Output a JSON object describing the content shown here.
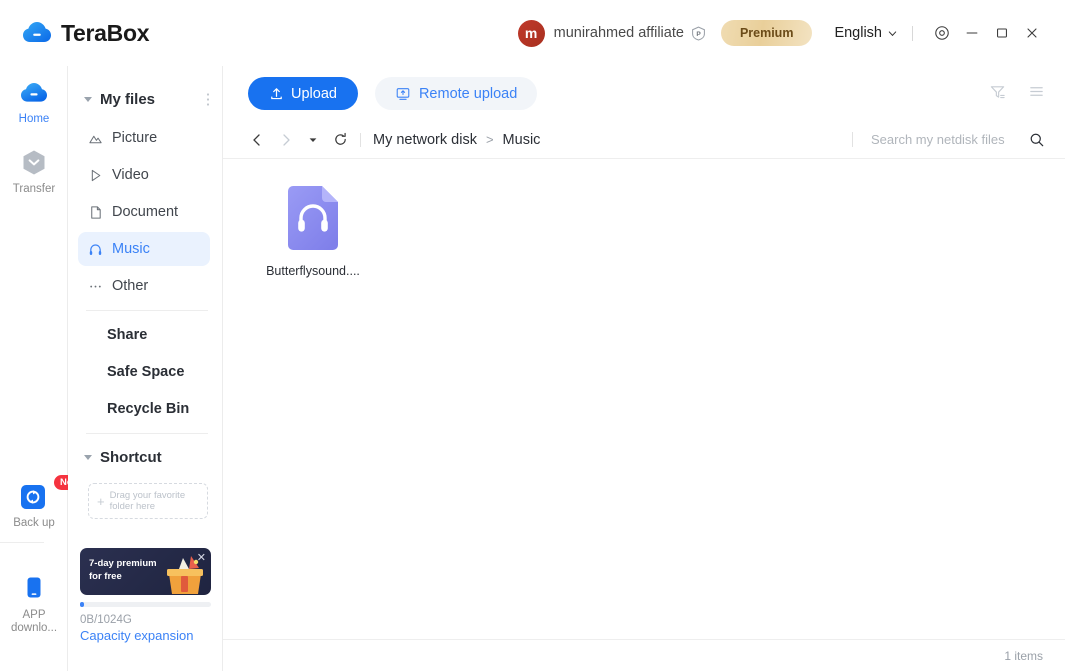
{
  "app": {
    "brand_name": "TeraBox",
    "logo_icon": "terabox-cloud-logo"
  },
  "titlebar": {
    "avatar_initial": "m",
    "username": "munirahmed affiliate",
    "p_badge_icon": "premium-p-shield-icon",
    "premium_label": "Premium",
    "language": "English",
    "language_caret_icon": "chevron-down-icon",
    "settings_icon": "settings-target-icon",
    "minimize_icon": "minimize-icon",
    "maximize_icon": "maximize-icon",
    "close_icon": "close-icon",
    "colors": {
      "avatar_bg": "#b8342a",
      "premium_bg": "#eed9ab",
      "premium_text": "#6b4b18",
      "brand_blue": "#1872f0"
    }
  },
  "rail": {
    "items": [
      {
        "label": "Home",
        "icon": "cloud-home-icon",
        "active": true
      },
      {
        "label": "Transfer",
        "icon": "transfer-hexagon-icon",
        "active": false
      },
      {
        "label": "Back up",
        "icon": "backup-sync-icon",
        "active": false,
        "badge": "New"
      },
      {
        "label": "APP downlo...",
        "icon": "app-download-phone-icon",
        "active": false
      }
    ]
  },
  "tree": {
    "header": {
      "label": "My files",
      "collapse_icon": "triangle-down-icon",
      "menu_icon": "more-vertical-icon"
    },
    "categories": [
      {
        "label": "Picture",
        "icon": "picture-icon",
        "selected": false
      },
      {
        "label": "Video",
        "icon": "video-play-icon",
        "selected": false
      },
      {
        "label": "Document",
        "icon": "document-icon",
        "selected": false
      },
      {
        "label": "Music",
        "icon": "headphones-icon",
        "selected": true
      },
      {
        "label": "Other",
        "icon": "ellipsis-icon",
        "selected": false
      }
    ],
    "links": [
      {
        "label": "Share"
      },
      {
        "label": "Safe Space"
      },
      {
        "label": "Recycle Bin"
      }
    ],
    "shortcut": {
      "label": "Shortcut",
      "collapse_icon": "triangle-down-icon",
      "dropzone_text": "Drag your favorite folder here",
      "dropzone_plus": "+"
    },
    "promo": {
      "line1": "7-day premium",
      "line2": "for free",
      "close_icon": "close-icon",
      "image_icon": "gift-box-icon"
    },
    "storage": {
      "used_total": "0B/1024G",
      "expand_link": "Capacity expansion",
      "percent": 0
    }
  },
  "toolbar": {
    "upload_label": "Upload",
    "upload_icon": "upload-arrow-icon",
    "remote_upload_label": "Remote upload",
    "remote_upload_icon": "remote-screen-icon",
    "filter_icon": "filter-sort-icon",
    "view_list_icon": "list-view-icon"
  },
  "navbar": {
    "back_icon": "chevron-left-icon",
    "forward_icon": "chevron-right-icon",
    "history_icon": "triangle-down-icon",
    "refresh_icon": "refresh-icon",
    "breadcrumb": [
      "My network disk",
      "Music"
    ],
    "breadcrumb_separator": ">",
    "search_placeholder": "Search my netdisk files",
    "search_value": "",
    "search_icon": "search-icon"
  },
  "files": {
    "items": [
      {
        "name": "Butterflysound....",
        "icon": "music-file-icon",
        "color": "#8b8bf0"
      }
    ]
  },
  "statusbar": {
    "count_label": "1 items"
  }
}
